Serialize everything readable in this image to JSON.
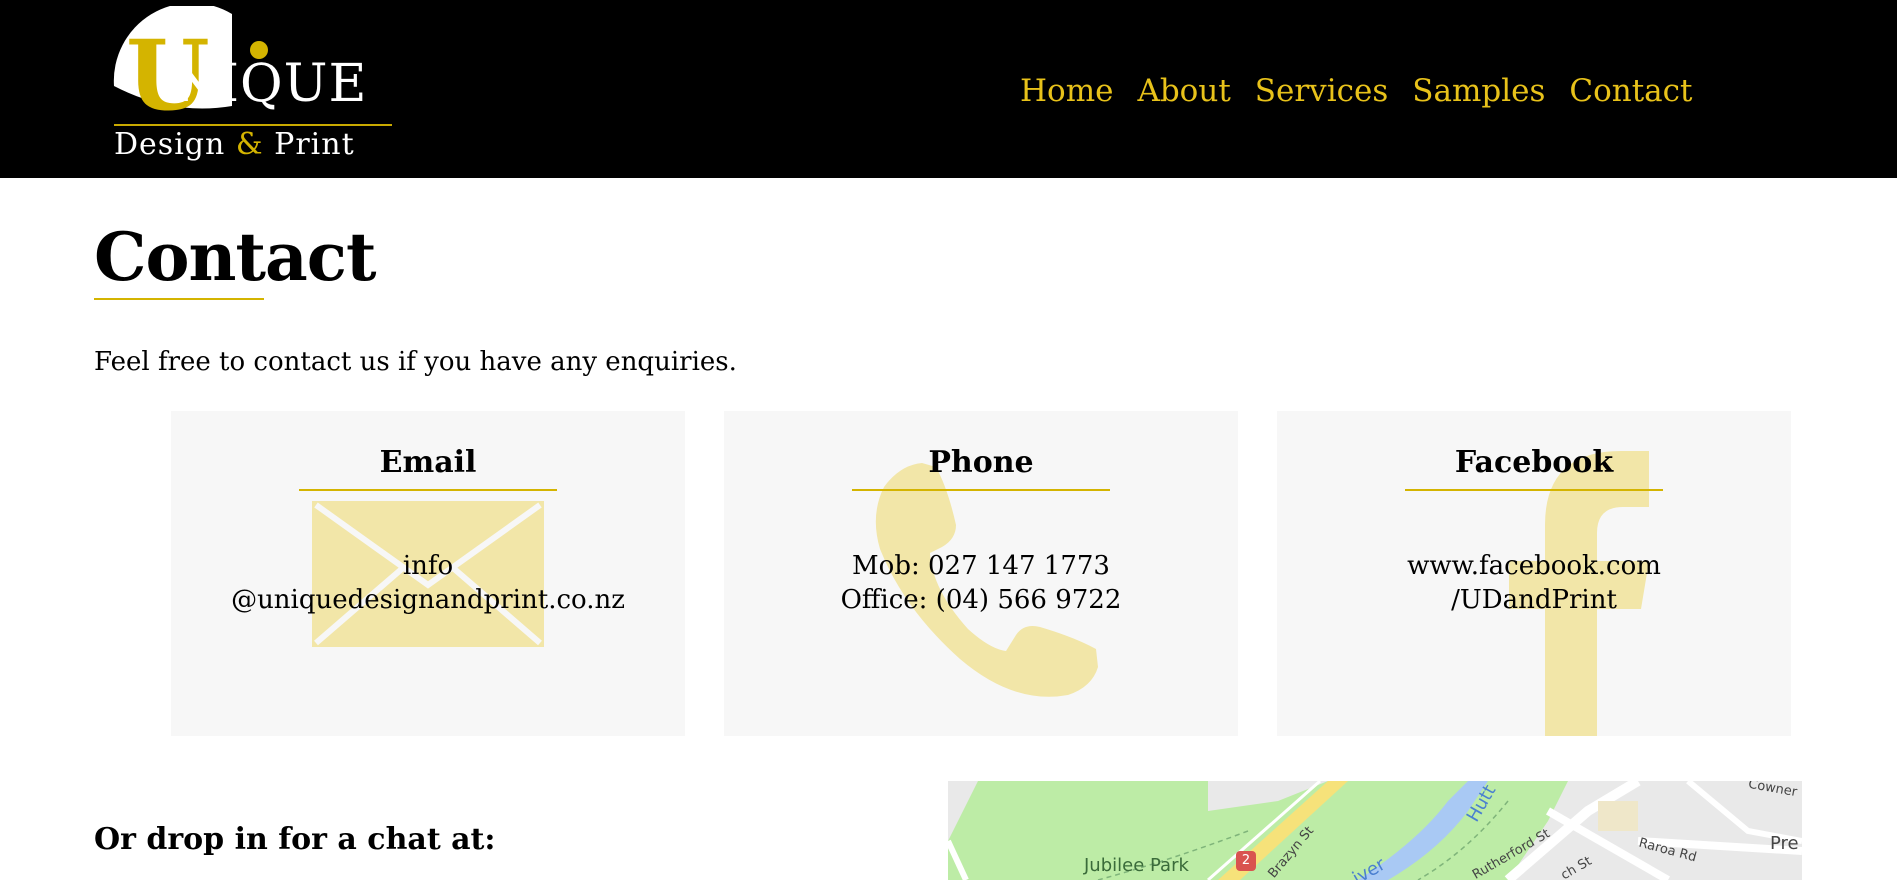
{
  "brand": {
    "logo_word": "NIQUE",
    "logo_letter": "U",
    "logo_sub_left": "Design",
    "logo_amp": "&",
    "logo_sub_right": "Print",
    "accent_color": "#d4b400"
  },
  "nav": {
    "items": [
      {
        "label": "Home"
      },
      {
        "label": "About"
      },
      {
        "label": "Services"
      },
      {
        "label": "Samples"
      },
      {
        "label": "Contact"
      }
    ]
  },
  "main": {
    "title": "Contact",
    "intro": "Feel free to contact us if you have any enquiries.",
    "cards": [
      {
        "title": "Email",
        "icon": "envelope-icon",
        "lines": [
          "info",
          "@uniquedesignandprint.co.nz"
        ]
      },
      {
        "title": "Phone",
        "icon": "phone-icon",
        "lines": [
          "Mob: 027 147 1773",
          "Office: (04) 566 9722"
        ]
      },
      {
        "title": "Facebook",
        "icon": "facebook-icon",
        "lines": [
          "www.facebook.com",
          "/UDandPrint"
        ]
      }
    ],
    "drop_heading": "Or drop in for a chat at:"
  },
  "map": {
    "labels": {
      "park": "Jubilee Park",
      "route_marker": "2",
      "river": "Hutt",
      "river2": "iver",
      "street1": "Brazyn St",
      "street2": "Rutherford St",
      "street3": "Raroa Rd",
      "street4": "ch St",
      "street5": "Pre",
      "street6": "Cowner"
    }
  }
}
